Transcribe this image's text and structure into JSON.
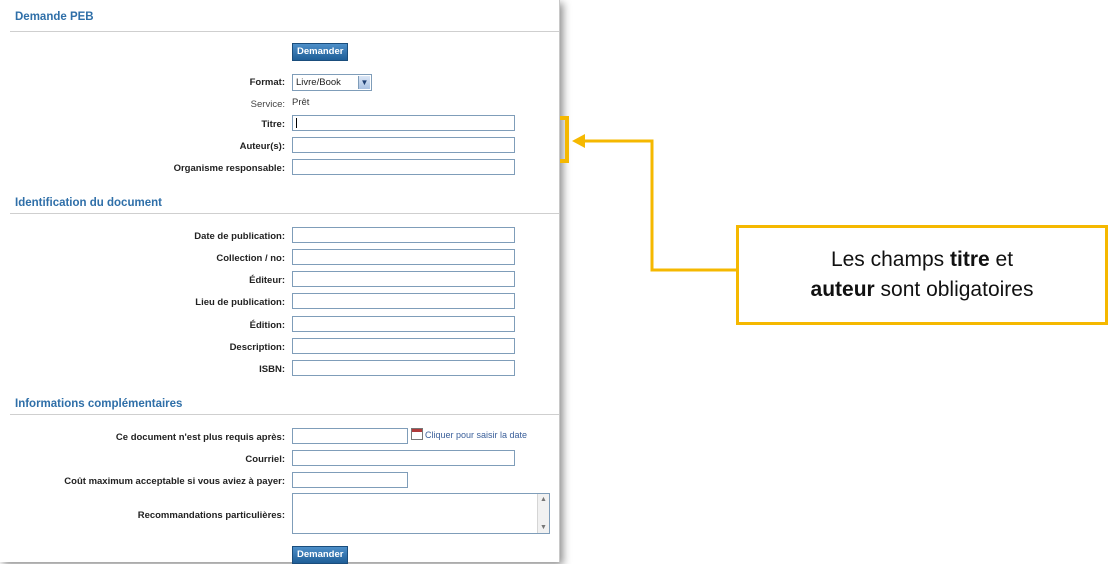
{
  "header": {
    "title": "Demande PEB"
  },
  "buttons": {
    "submit_top": "Demander",
    "submit_bottom": "Demander"
  },
  "request": {
    "format_label": "Format:",
    "format_value": "Livre/Book",
    "service_label": "Service:",
    "service_value": "Prêt",
    "title_label": "Titre:",
    "authors_label": "Auteur(s):",
    "organization_label": "Organisme responsable:"
  },
  "identification": {
    "title": "Identification du document",
    "fields": {
      "publication_date": "Date de publication:",
      "collection": "Collection / no:",
      "publisher": "Éditeur:",
      "publication_place": "Lieu de publication:",
      "edition": "Édition:",
      "description": "Description:",
      "isbn": "ISBN:"
    }
  },
  "additional": {
    "title": "Informations complémentaires",
    "fields": {
      "not_needed_after": "Ce document n'est plus requis après:",
      "date_picker_label": "Cliquer pour saisir la date",
      "email": "Courriel:",
      "max_cost": "Coût maximum acceptable si vous aviez à payer:",
      "recommendations": "Recommandations particulières:"
    }
  },
  "callout": {
    "text_1": "Les champs ",
    "bold_1": "titre",
    "text_2": " et",
    "bold_2": "auteur",
    "text_3": " sont obligatoires"
  },
  "colors": {
    "callout_border": "#f5b800",
    "section_title": "#2f6fa8",
    "button": "#1f5e97"
  },
  "icons": {
    "calendar": "calendar-icon",
    "dropdown": "chevron-down-icon"
  }
}
